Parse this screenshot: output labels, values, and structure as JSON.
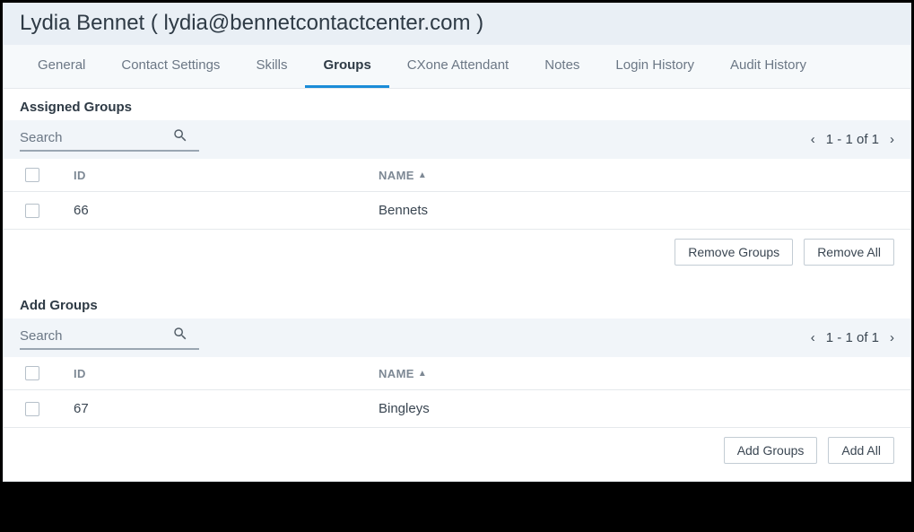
{
  "header": {
    "title": "Lydia Bennet ( lydia@bennetcontactcenter.com )"
  },
  "tabs": [
    {
      "label": "General",
      "active": false
    },
    {
      "label": "Contact Settings",
      "active": false
    },
    {
      "label": "Skills",
      "active": false
    },
    {
      "label": "Groups",
      "active": true
    },
    {
      "label": "CXone Attendant",
      "active": false
    },
    {
      "label": "Notes",
      "active": false
    },
    {
      "label": "Login History",
      "active": false
    },
    {
      "label": "Audit History",
      "active": false
    }
  ],
  "assigned": {
    "title": "Assigned Groups",
    "search_placeholder": "Search",
    "pager_text": "1 - 1 of 1",
    "columns": {
      "id": "ID",
      "name": "NAME"
    },
    "rows": [
      {
        "id": "66",
        "name": "Bennets"
      }
    ],
    "actions": {
      "remove_groups": "Remove Groups",
      "remove_all": "Remove All"
    }
  },
  "add": {
    "title": "Add Groups",
    "search_placeholder": "Search",
    "pager_text": "1 - 1 of 1",
    "columns": {
      "id": "ID",
      "name": "NAME"
    },
    "rows": [
      {
        "id": "67",
        "name": "Bingleys"
      }
    ],
    "actions": {
      "add_groups": "Add Groups",
      "add_all": "Add All"
    }
  }
}
